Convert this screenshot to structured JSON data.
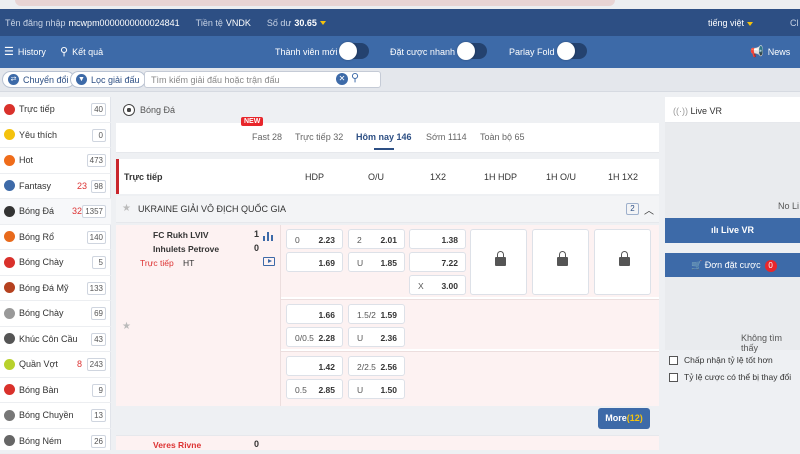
{
  "header": {
    "username_label": "Tên đăng nhập",
    "username": "mcwpm0000000000024841",
    "currency_label": "Tiền tệ",
    "currency": "VNDK",
    "balance_label": "Số dư",
    "balance": "30.65",
    "language": "tiếng việt",
    "extra": "Cl"
  },
  "menu": {
    "history": "History",
    "results": "Kết quả",
    "new_member": "Thành viên mới",
    "quick_bet": "Đặt cược nhanh",
    "parlay_fold": "Parlay Fold",
    "news": "News"
  },
  "filters": {
    "switch": "Chuyển đổi",
    "league_filter": "Lọc giải đấu",
    "search_placeholder": "Tìm kiếm giải đấu hoặc trận đấu"
  },
  "sidebar": {
    "items": [
      {
        "label": "Trực tiếp",
        "live": "",
        "count": "40",
        "color": "#d9312b"
      },
      {
        "label": "Yêu thích",
        "live": "",
        "count": "0",
        "color": "#f4c20d"
      },
      {
        "label": "Hot",
        "live": "",
        "count": "473",
        "color": "#ef6c1a"
      },
      {
        "label": "Fantasy",
        "live": "23",
        "count": "98",
        "color": "#3d6aa8"
      },
      {
        "label": "Bóng Đá",
        "live": "32",
        "count": "1357",
        "color": "#333333"
      },
      {
        "label": "Bóng Rổ",
        "live": "",
        "count": "140",
        "color": "#e86a1c"
      },
      {
        "label": "Bóng Chày",
        "live": "",
        "count": "5",
        "color": "#d9312b"
      },
      {
        "label": "Bóng Đá Mỹ",
        "live": "",
        "count": "133",
        "color": "#b5411f"
      },
      {
        "label": "Bóng Chày",
        "live": "",
        "count": "69",
        "color": "#999999"
      },
      {
        "label": "Khúc Côn Cầu",
        "live": "",
        "count": "43",
        "color": "#555555"
      },
      {
        "label": "Quần Vợt",
        "live": "8",
        "count": "243",
        "color": "#b8d12c"
      },
      {
        "label": "Bóng Bàn",
        "live": "",
        "count": "9",
        "color": "#d9312b"
      },
      {
        "label": "Bóng Chuyền",
        "live": "",
        "count": "13",
        "color": "#777777"
      },
      {
        "label": "Bóng Ném",
        "live": "",
        "count": "26",
        "color": "#666666"
      }
    ]
  },
  "main": {
    "sport_title": "Bóng Đá",
    "new_badge": "NEW",
    "tabs": [
      "Fast 28",
      "Trực tiếp 32",
      "Hôm nay 146",
      "Sớm 1114",
      "Toàn bộ 65"
    ],
    "columns": [
      "Trực tiếp",
      "HDP",
      "O/U",
      "1X2",
      "1H HDP",
      "1H O/U",
      "1H 1X2"
    ],
    "league": {
      "name": "UKRAINE GIẢI VÔ ĐỊCH QUỐC GIA",
      "count": "2"
    },
    "match": {
      "home": "FC Rukh LVIV",
      "away": "Inhulets Petrove",
      "home_score": "1",
      "away_score": "0",
      "live": "Trực tiếp",
      "period": "HT",
      "rows": [
        {
          "hdp_h": "0",
          "hdp_o1": "2.23",
          "hdp_o2": "1.69",
          "ou_h1": "2",
          "ou_o1": "2.01",
          "ou_h2": "U",
          "ou_o2": "1.85",
          "x1": "1.38",
          "x2": "7.22",
          "x3h": "X",
          "x3": "3.00"
        },
        {
          "hdp_h1": "",
          "hdp_o1": "1.66",
          "hdp_h2": "0/0.5",
          "hdp_o2": "2.28",
          "ou_h1": "1.5/2",
          "ou_o1": "1.59",
          "ou_h2": "U",
          "ou_o2": "2.36"
        },
        {
          "hdp_h1": "",
          "hdp_o1": "1.42",
          "hdp_h2": "0.5",
          "hdp_o2": "2.85",
          "ou_h1": "2/2.5",
          "ou_o1": "2.56",
          "ou_h2": "U",
          "ou_o2": "1.50"
        }
      ],
      "more_label": "More",
      "more_count": "(12)"
    },
    "next_match": {
      "home": "Veres Rivne",
      "home_score": "0"
    }
  },
  "right": {
    "live_vr": "Live VR",
    "no_live": "No Li",
    "live_vr_btn": "Live VR",
    "betslip": "Đơn đặt cược",
    "betslip_count": "0",
    "no_bets": "Không tìm thấy",
    "accept_odds": "Chấp nhận tỷ lệ tốt hơn",
    "odds_change": "Tỷ lệ cược có thể bị thay đổi"
  }
}
